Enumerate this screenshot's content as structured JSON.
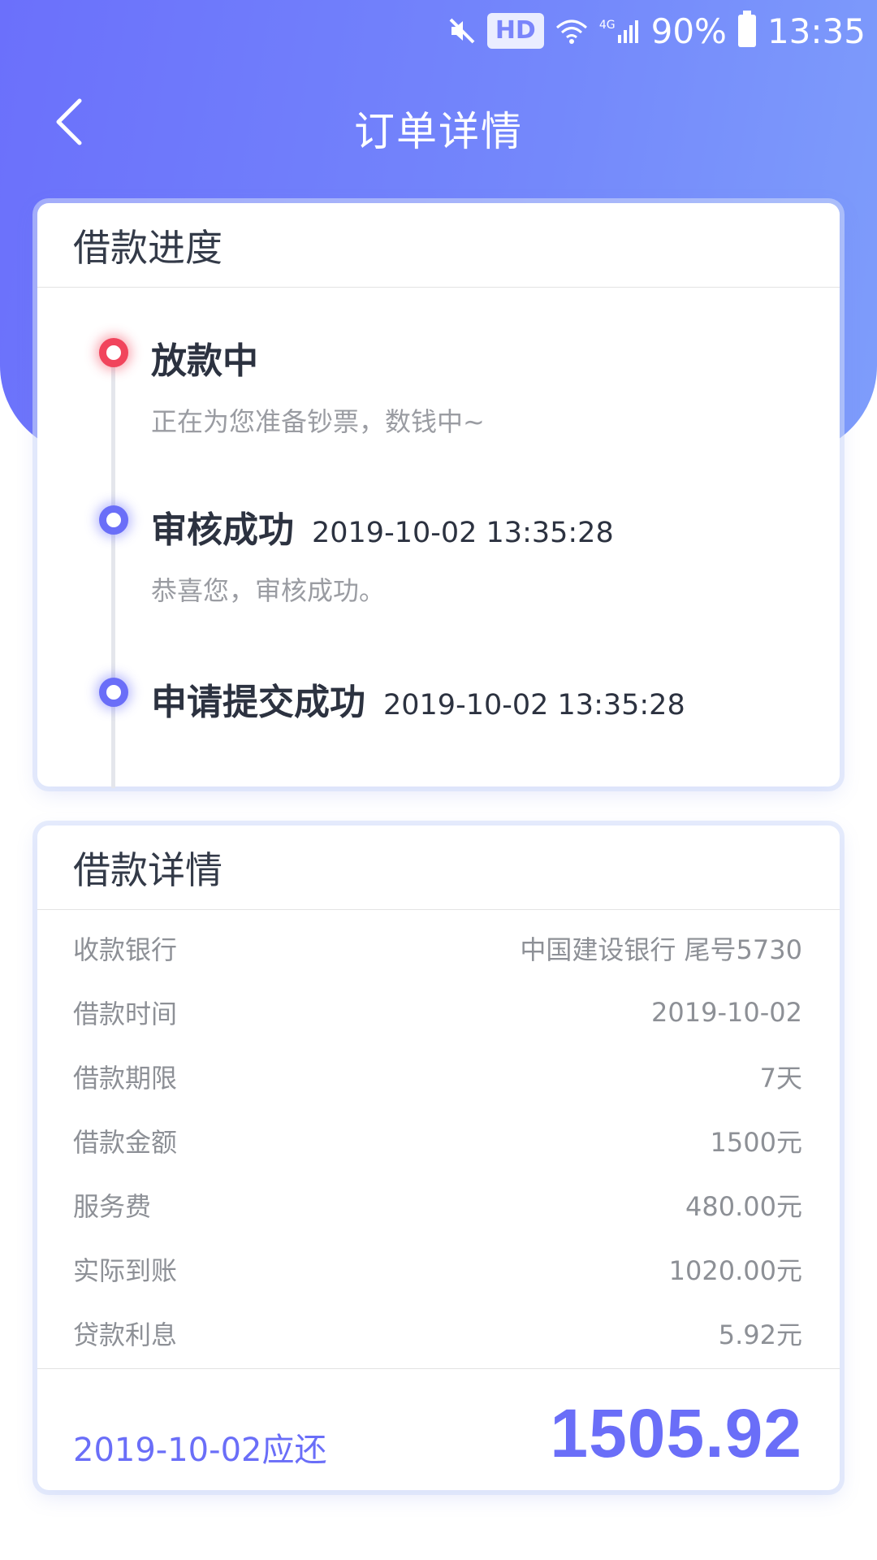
{
  "status_bar": {
    "hd": "HD",
    "network": "4G",
    "battery": "90%",
    "time": "13:35"
  },
  "nav": {
    "title": "订单详情"
  },
  "progress": {
    "title": "借款进度",
    "steps": [
      {
        "title": "放款中",
        "time": "",
        "desc": "正在为您准备钞票，数钱中~",
        "state": "current"
      },
      {
        "title": "审核成功",
        "time": "2019-10-02 13:35:28",
        "desc": "恭喜您，审核成功。",
        "state": "done"
      },
      {
        "title": "申请提交成功",
        "time": "2019-10-02 13:35:28",
        "desc": "",
        "state": "done"
      }
    ]
  },
  "details": {
    "title": "借款详情",
    "rows": [
      {
        "label": "收款银行",
        "value": "中国建设银行 尾号5730"
      },
      {
        "label": "借款时间",
        "value": "2019-10-02"
      },
      {
        "label": "借款期限",
        "value": "7天"
      },
      {
        "label": "借款金额",
        "value": "1500元"
      },
      {
        "label": "服务费",
        "value": "480.00元"
      },
      {
        "label": "实际到账",
        "value": "1020.00元"
      },
      {
        "label": "贷款利息",
        "value": "5.92元"
      }
    ],
    "due_label": "2019-10-02应还",
    "due_amount": "1505.92"
  },
  "colors": {
    "accent": "#6a6ef8",
    "current": "#f1445c",
    "header_start": "#6b70fb",
    "header_end": "#7e9dfb"
  }
}
